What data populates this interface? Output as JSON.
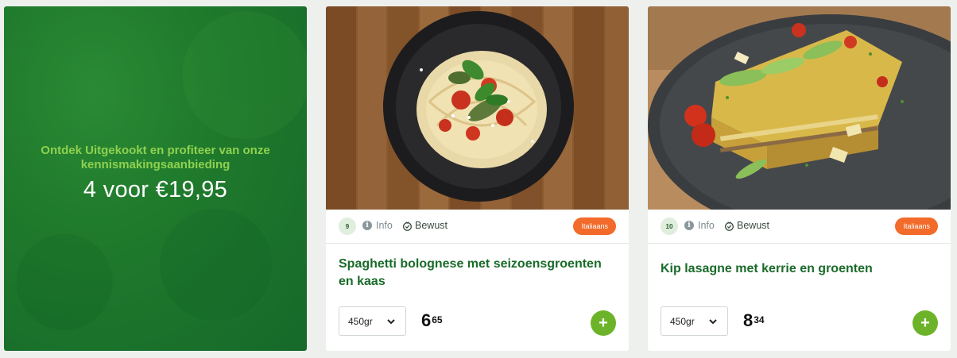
{
  "promo": {
    "subtitle": "Ontdek Uitgekookt en profiteer van onze kennismakingsaanbieding",
    "headline": "4 voor €19,95"
  },
  "products": [
    {
      "number": "9",
      "info_label": "Info",
      "bewust_label": "Bewust",
      "category": "Italiaans",
      "title": "Spaghetti bolognese met seizoensgroenten en kaas",
      "portion": "450gr",
      "price_whole": "6",
      "price_cents": "65",
      "add_label": "+",
      "image": "spaghetti-bolognese-photo"
    },
    {
      "number": "10",
      "info_label": "Info",
      "bewust_label": "Bewust",
      "category": "Italiaans",
      "title": "Kip lasagne met kerrie en groenten",
      "portion": "450gr",
      "price_whole": "8",
      "price_cents": "34",
      "add_label": "+",
      "image": "kip-lasagne-photo"
    }
  ],
  "colors": {
    "brand_green": "#1a6b2a",
    "promo_accent": "#8fd14f",
    "tag_orange": "#f26b2a",
    "add_green": "#6db32a"
  }
}
